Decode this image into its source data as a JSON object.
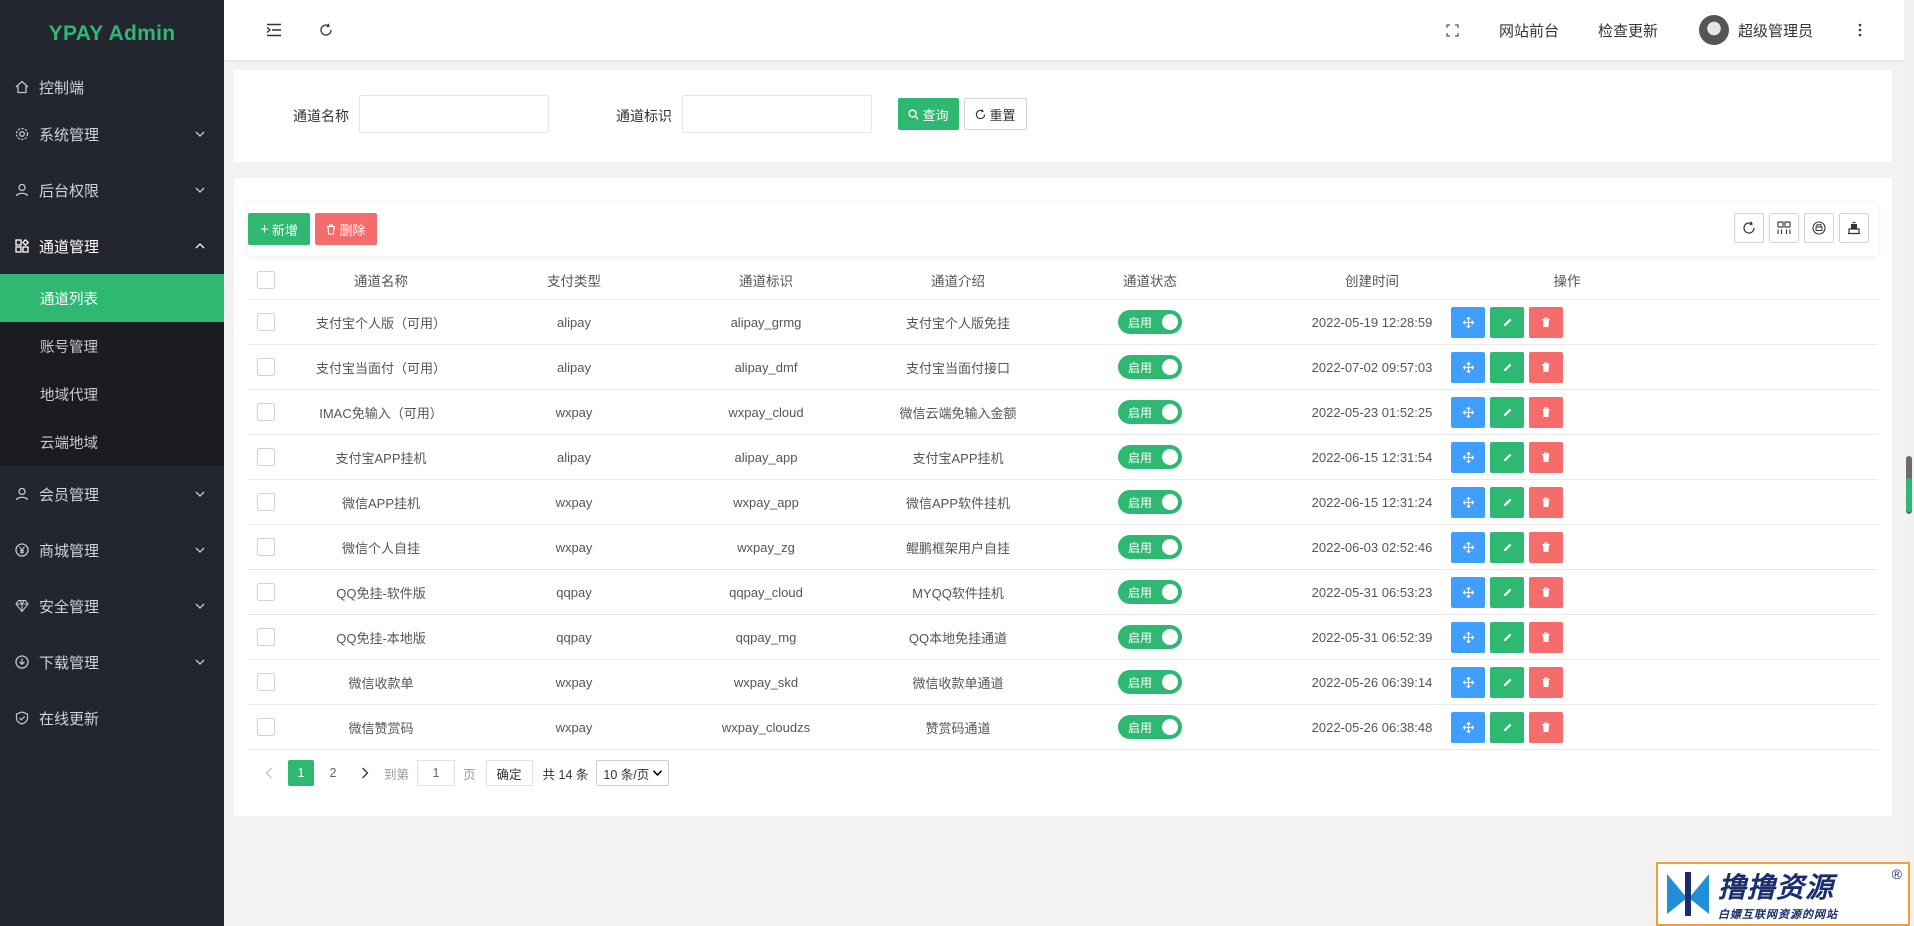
{
  "brand": "YPAY Admin",
  "colors": {
    "accent": "#2eb872",
    "sidebar_bg": "#23262e",
    "danger": "#f56c6c",
    "info": "#409eff"
  },
  "sidebar": {
    "items": [
      {
        "label": "控制端",
        "icon": "home-icon"
      },
      {
        "label": "系统管理",
        "icon": "gear-icon"
      },
      {
        "label": "后台权限",
        "icon": "user-icon"
      },
      {
        "label": "通道管理",
        "icon": "apps-icon"
      },
      {
        "label": "会员管理",
        "icon": "user-icon"
      },
      {
        "label": "商城管理",
        "icon": "yen-icon"
      },
      {
        "label": "安全管理",
        "icon": "diamond-icon"
      },
      {
        "label": "下载管理",
        "icon": "download-icon"
      },
      {
        "label": "在线更新",
        "icon": "shield-check-icon"
      }
    ],
    "submenu": [
      {
        "label": "通道列表"
      },
      {
        "label": "账号管理"
      },
      {
        "label": "地域代理"
      },
      {
        "label": "云端地域"
      }
    ]
  },
  "header": {
    "front_link": "网站前台",
    "check_update": "检查更新",
    "username": "超级管理员"
  },
  "search": {
    "name_label": "通道名称",
    "code_label": "通道标识",
    "query_button": "查询",
    "reset_button": "重置"
  },
  "toolbar": {
    "add_button": "新增",
    "delete_button": "删除"
  },
  "table": {
    "columns": [
      "通道名称",
      "支付类型",
      "通道标识",
      "通道介绍",
      "通道状态",
      "创建时间",
      "操作"
    ],
    "rows": [
      {
        "name": "支付宝个人版（可用）",
        "type": "alipay",
        "code": "alipay_grmg",
        "intro": "支付宝个人版免挂",
        "status": "启用",
        "created": "2022-05-19 12:28:59"
      },
      {
        "name": "支付宝当面付（可用）",
        "type": "alipay",
        "code": "alipay_dmf",
        "intro": "支付宝当面付接口",
        "status": "启用",
        "created": "2022-07-02 09:57:03"
      },
      {
        "name": "IMAC免输入（可用）",
        "type": "wxpay",
        "code": "wxpay_cloud",
        "intro": "微信云端免输入金额",
        "status": "启用",
        "created": "2022-05-23 01:52:25"
      },
      {
        "name": "支付宝APP挂机",
        "type": "alipay",
        "code": "alipay_app",
        "intro": "支付宝APP挂机",
        "status": "启用",
        "created": "2022-06-15 12:31:54"
      },
      {
        "name": "微信APP挂机",
        "type": "wxpay",
        "code": "wxpay_app",
        "intro": "微信APP软件挂机",
        "status": "启用",
        "created": "2022-06-15 12:31:24"
      },
      {
        "name": "微信个人自挂",
        "type": "wxpay",
        "code": "wxpay_zg",
        "intro": "鲲鹏框架用户自挂",
        "status": "启用",
        "created": "2022-06-03 02:52:46"
      },
      {
        "name": "QQ免挂-软件版",
        "type": "qqpay",
        "code": "qqpay_cloud",
        "intro": "MYQQ软件挂机",
        "status": "启用",
        "created": "2022-05-31 06:53:23"
      },
      {
        "name": "QQ免挂-本地版",
        "type": "qqpay",
        "code": "qqpay_mg",
        "intro": "QQ本地免挂通道",
        "status": "启用",
        "created": "2022-05-31 06:52:39"
      },
      {
        "name": "微信收款单",
        "type": "wxpay",
        "code": "wxpay_skd",
        "intro": "微信收款单通道",
        "status": "启用",
        "created": "2022-05-26 06:39:14"
      },
      {
        "name": "微信赞赏码",
        "type": "wxpay",
        "code": "wxpay_cloudzs",
        "intro": "赞赏码通道",
        "status": "启用",
        "created": "2022-05-26 06:38:48"
      }
    ]
  },
  "pagination": {
    "pages": [
      "1",
      "2"
    ],
    "current": "1",
    "goto_prefix": "到第",
    "goto_value": "1",
    "goto_suffix": "页",
    "confirm": "确定",
    "total": "共 14 条",
    "page_size": "10 条/页"
  },
  "watermark": {
    "title": "撸撸资源",
    "subtitle": "白嫖互联网资源的网站",
    "reg": "®"
  }
}
